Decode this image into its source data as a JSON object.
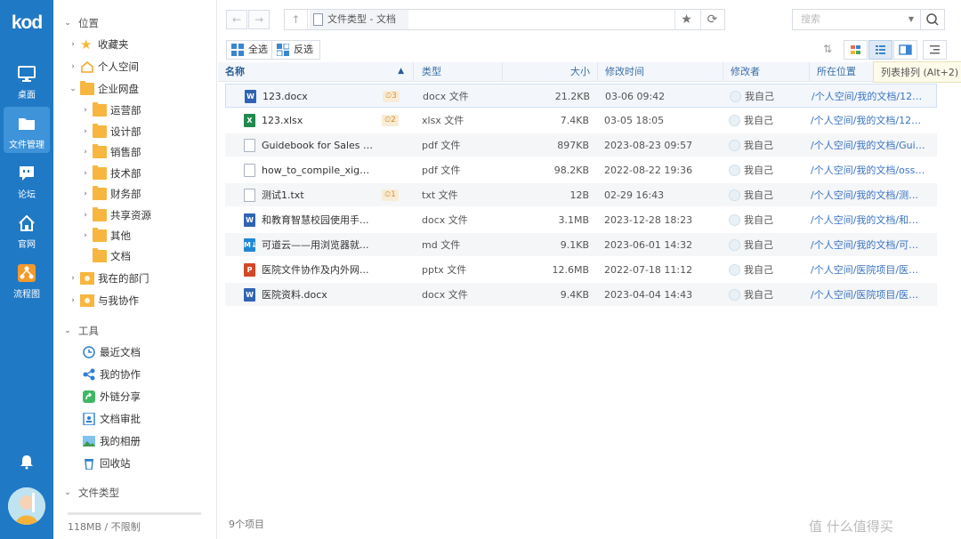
{
  "app": {
    "logo": "kod"
  },
  "nav": {
    "items": [
      {
        "label": "桌面",
        "icon": "monitor-icon"
      },
      {
        "label": "文件管理",
        "icon": "folder-icon"
      },
      {
        "label": "论坛",
        "icon": "forum-icon"
      },
      {
        "label": "官网",
        "icon": "home-icon"
      },
      {
        "label": "流程图",
        "icon": "flowchart-icon"
      }
    ],
    "bell_icon": "bell-icon",
    "avatar_icon": "user-avatar"
  },
  "tree": {
    "location_header": "位置",
    "favorites": "收藏夹",
    "personal": "个人空间",
    "enterprise": "企业网盘",
    "departments": [
      "运营部",
      "设计部",
      "销售部",
      "技术部",
      "财务部"
    ],
    "shared": "共享资源",
    "other": "其他",
    "docs": "文档",
    "my_dept": "我在的部门",
    "collab_with_me": "与我协作",
    "tools_header": "工具",
    "tools": [
      "最近文档",
      "我的协作",
      "外链分享",
      "文档审批",
      "我的相册",
      "回收站"
    ],
    "types_header": "文件类型",
    "quota": "118MB / 不限制"
  },
  "pathbar": {
    "crumb": "文件类型 - 文档",
    "search_placeholder": "搜索"
  },
  "toolbar": {
    "select_all": "全选",
    "invert": "反选",
    "tooltip": "列表排列 (Alt+2)"
  },
  "colors": {
    "nav_bg": "#2079c5",
    "link": "#3b74c2",
    "version_badge": "#d8902a"
  },
  "table": {
    "headers": {
      "name": "名称",
      "type": "类型",
      "size": "大小",
      "mtime": "修改时间",
      "modifier": "修改者",
      "location": "所在位置"
    },
    "rows": [
      {
        "name": "123.docx",
        "kind": "word",
        "badge": "3",
        "type": "docx 文件",
        "size": "21.2KB",
        "time": "03-06 09:42",
        "user": "我自己",
        "loc": "/个人空间/我的文档/123.docx"
      },
      {
        "name": "123.xlsx",
        "kind": "excel",
        "badge": "2",
        "type": "xlsx 文件",
        "size": "7.4KB",
        "time": "03-05 18:05",
        "user": "我自己",
        "loc": "/个人空间/我的文档/123.xlsx"
      },
      {
        "name": "Guidebook for Sales Inf...",
        "kind": "pdf",
        "badge": "",
        "type": "pdf 文件",
        "size": "897KB",
        "time": "2023-08-23 09:57",
        "user": "我自己",
        "loc": "/个人空间/我的文档/Guid..."
      },
      {
        "name": "how_to_compile_xigma...",
        "kind": "pdf",
        "badge": "",
        "type": "pdf 文件",
        "size": "98.2KB",
        "time": "2022-08-22 19:36",
        "user": "我自己",
        "loc": "/个人空间/我的文档/oss/..."
      },
      {
        "name": "测试1.txt",
        "kind": "txt",
        "badge": "1",
        "type": "txt 文件",
        "size": "12B",
        "time": "02-29 16:43",
        "user": "我自己",
        "loc": "/个人空间/我的文档/测试..."
      },
      {
        "name": "和教育智慧校园使用手...",
        "kind": "word",
        "badge": "",
        "type": "docx 文件",
        "size": "3.1MB",
        "time": "2023-12-28 18:23",
        "user": "我自己",
        "loc": "/个人空间/我的文档/和教..."
      },
      {
        "name": "可道云——用浏览器就...",
        "kind": "md",
        "badge": "",
        "type": "md 文件",
        "size": "9.1KB",
        "time": "2023-06-01 14:32",
        "user": "我自己",
        "loc": "/个人空间/我的文档/可道..."
      },
      {
        "name": "医院文件协作及内外网...",
        "kind": "ppt",
        "badge": "",
        "type": "pptx 文件",
        "size": "12.6MB",
        "time": "2022-07-18 11:12",
        "user": "我自己",
        "loc": "/个人空间/医院项目/医院..."
      },
      {
        "name": "医院资料.docx",
        "kind": "word",
        "badge": "",
        "type": "docx 文件",
        "size": "9.4KB",
        "time": "2023-04-04 14:43",
        "user": "我自己",
        "loc": "/个人空间/医院项目/医院..."
      }
    ]
  },
  "footer": {
    "count": "9个项目",
    "watermark": "值 什么值得买"
  }
}
